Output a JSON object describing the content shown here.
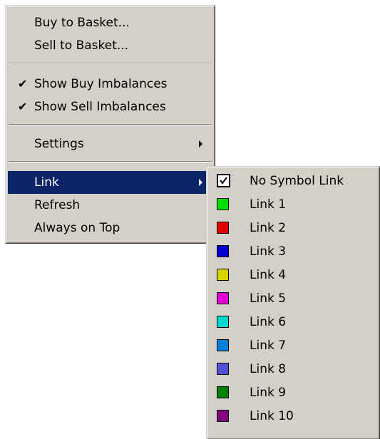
{
  "main_menu": {
    "items": [
      {
        "label": "Buy to Basket..."
      },
      {
        "label": "Sell to Basket..."
      },
      {
        "label": "Show Buy Imbalances",
        "checked": true
      },
      {
        "label": "Show Sell Imbalances",
        "checked": true
      },
      {
        "label": "Settings",
        "submenu": true
      },
      {
        "label": "Link",
        "submenu": true,
        "highlighted": true
      },
      {
        "label": "Refresh"
      },
      {
        "label": "Always on Top"
      }
    ]
  },
  "link_submenu": {
    "items": [
      {
        "label": "No Symbol Link",
        "checked": true
      },
      {
        "label": "Link 1",
        "color": "#00e000"
      },
      {
        "label": "Link 2",
        "color": "#e00000"
      },
      {
        "label": "Link 3",
        "color": "#0000d0"
      },
      {
        "label": "Link 4",
        "color": "#d8d000"
      },
      {
        "label": "Link 5",
        "color": "#e000d8"
      },
      {
        "label": "Link 6",
        "color": "#00d8d0"
      },
      {
        "label": "Link 7",
        "color": "#0080d8"
      },
      {
        "label": "Link 8",
        "color": "#5050d8"
      },
      {
        "label": "Link 9",
        "color": "#008000"
      },
      {
        "label": "Link 10",
        "color": "#800080"
      }
    ]
  },
  "colors": {
    "menu_bg": "#d4d0c8",
    "highlight_bg": "#0a246a",
    "highlight_text": "#ffffff"
  },
  "icons": {
    "check": "check-mark-icon",
    "submenu": "submenu-arrow-icon"
  }
}
